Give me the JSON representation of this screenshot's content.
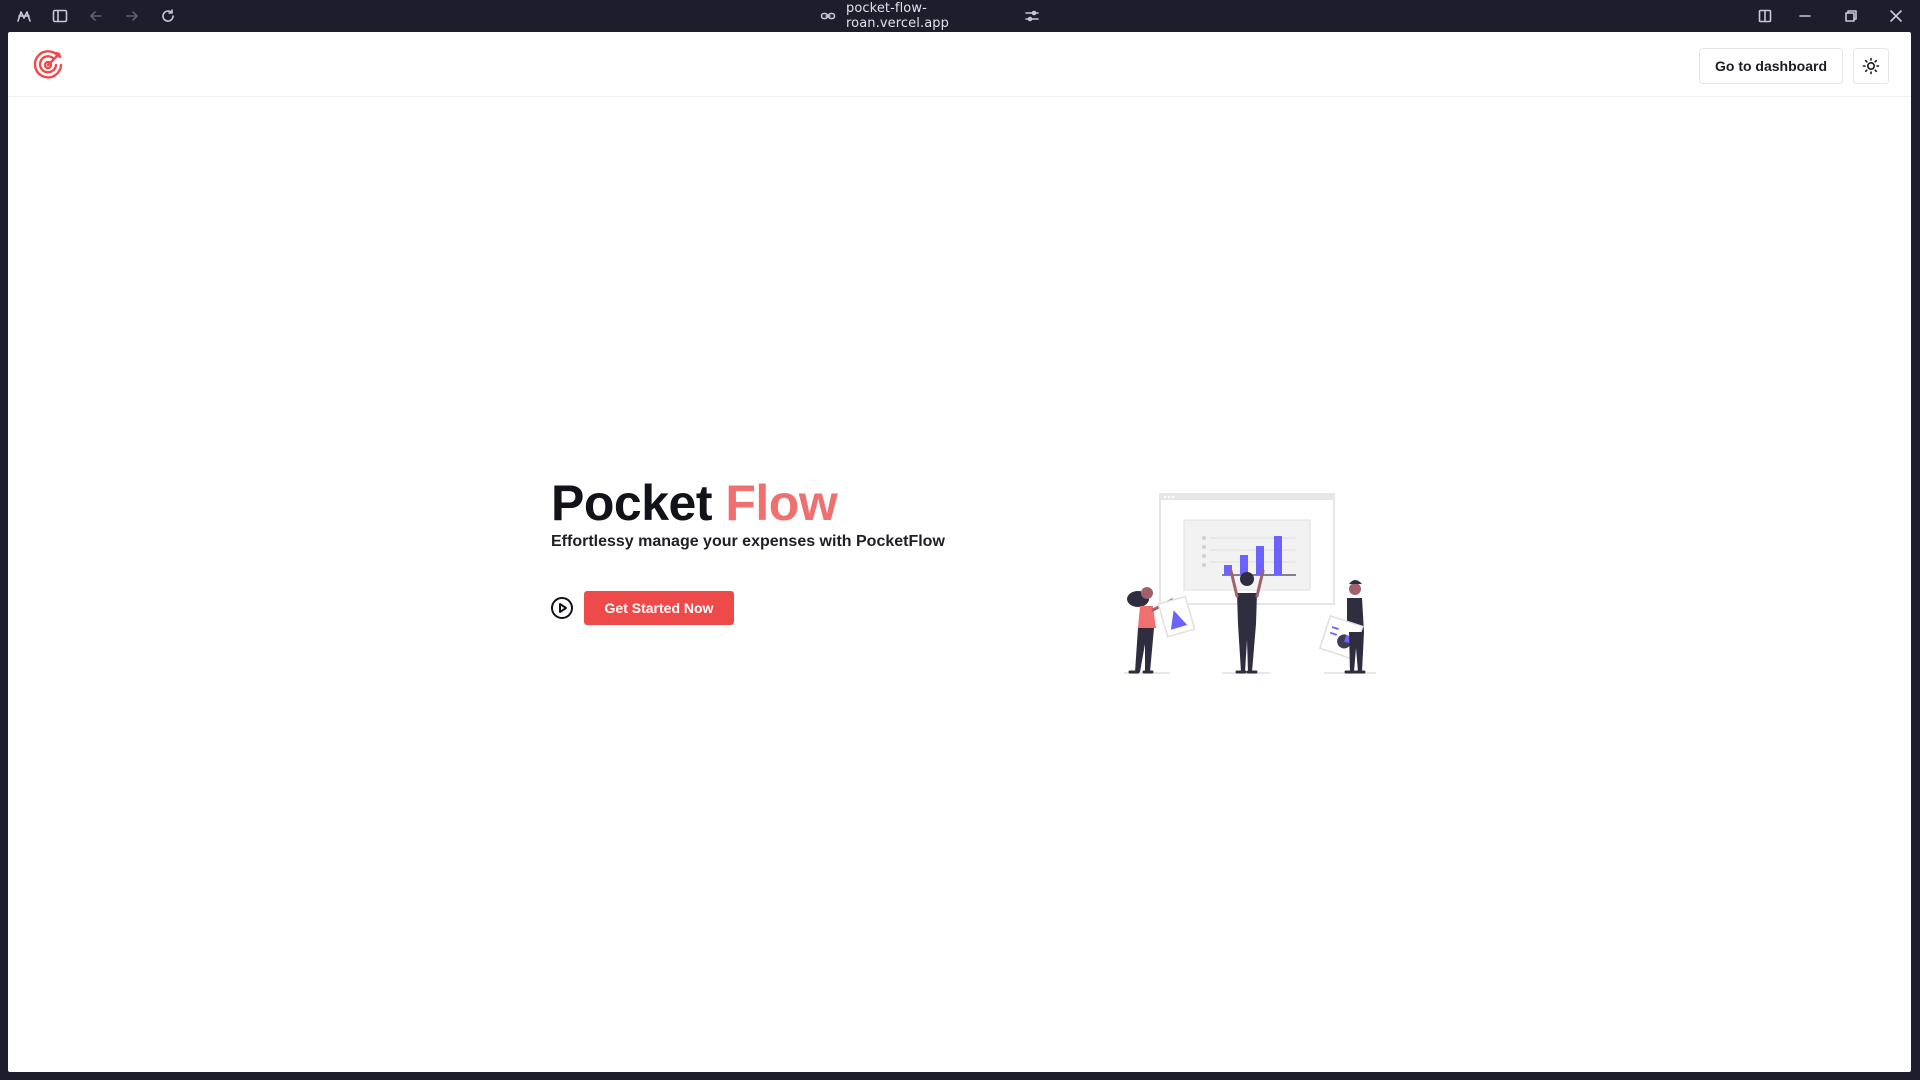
{
  "browser": {
    "url": "pocket-flow-roan.vercel.app",
    "icons": [
      "app-menu-icon",
      "sidebar-icon",
      "back-icon",
      "forward-icon",
      "reload-icon",
      "link-icon",
      "site-settings-icon",
      "split-view-icon",
      "minimize-icon",
      "restore-icon",
      "close-icon"
    ]
  },
  "header": {
    "logo": "pocketflow-logo",
    "dashboard_label": "Go to dashboard",
    "theme_icon": "sun-icon"
  },
  "hero": {
    "title_main": "Pocket",
    "title_accent": "Flow",
    "subtitle": "Effortlessy manage your expenses with PocketFlow",
    "cta_label": "Get Started Now",
    "play_icon": "play-circle-icon"
  },
  "colors": {
    "accent": "#f07070",
    "cta": "#ef4a4a",
    "chrome": "#1d1d2b",
    "chart_bars": "#6c63ff"
  }
}
